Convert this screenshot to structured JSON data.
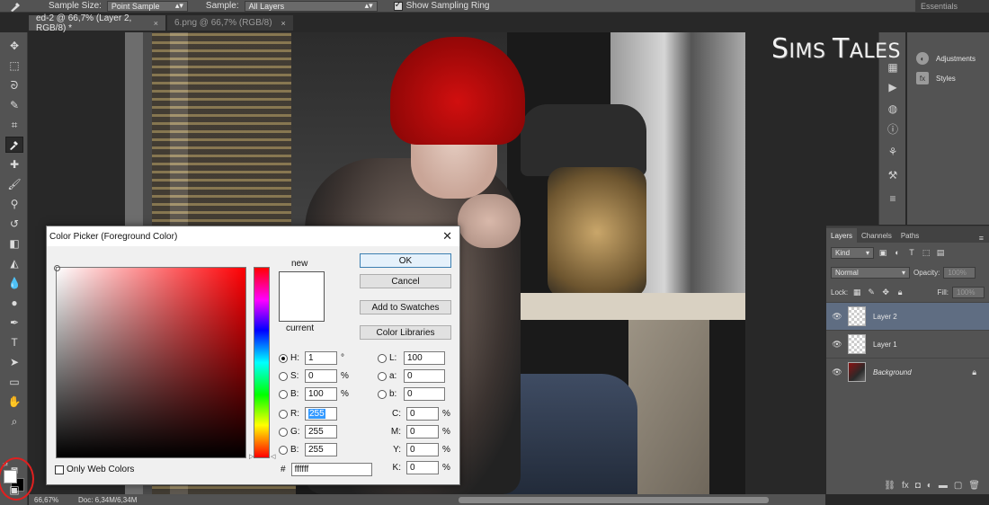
{
  "options_bar": {
    "sample_size_label": "Sample Size:",
    "sample_size_value": "Point Sample",
    "sample_label": "Sample:",
    "sample_value": "All Layers",
    "show_ring_label": "Show Sampling Ring",
    "workspace": "Essentials"
  },
  "tabs": [
    {
      "label": "ed-2 @ 66,7% (Layer 2, RGB/8) *",
      "close": "×"
    },
    {
      "label": "6.png @ 66,7% (RGB/8)",
      "close": "×"
    }
  ],
  "watermark": {
    "big1": "S",
    "small1": "IMS ",
    "big2": "T",
    "small2": "ALES"
  },
  "status_bar": {
    "zoom": "66,67%",
    "doc": "Doc: 6,34M/6,34M"
  },
  "panels": {
    "adjustments": "Adjustments",
    "styles": "Styles"
  },
  "layers_panel": {
    "tabs": [
      "Layers",
      "Channels",
      "Paths"
    ],
    "filter_kind": "Kind",
    "blend_mode": "Normal",
    "opacity_label": "Opacity:",
    "opacity_value": "100%",
    "lock_label": "Lock:",
    "fill_label": "Fill:",
    "fill_value": "100%",
    "layers": [
      {
        "name": "Layer 2",
        "active": true
      },
      {
        "name": "Layer 1",
        "active": false
      },
      {
        "name": "Background",
        "active": false,
        "locked": true
      }
    ]
  },
  "color_picker": {
    "title": "Color Picker (Foreground Color)",
    "close": "✕",
    "new_label": "new",
    "current_label": "current",
    "new_color": "#ffffff",
    "current_color": "#ffffff",
    "buttons": {
      "ok": "OK",
      "cancel": "Cancel",
      "add_swatches": "Add to Swatches",
      "libraries": "Color Libraries"
    },
    "hsb": {
      "h": "1",
      "h_unit": "°",
      "s": "0",
      "s_unit": "%",
      "b": "100",
      "b_unit": "%"
    },
    "rgb": {
      "r": "255",
      "g": "255",
      "b": "255"
    },
    "lab": {
      "l": "100",
      "a": "0",
      "b": "0"
    },
    "cmyk": {
      "c": "0",
      "m": "0",
      "y": "0",
      "k": "0",
      "unit": "%"
    },
    "hex_label": "#",
    "hex": "ffffff",
    "web_colors_label": "Only Web Colors"
  }
}
